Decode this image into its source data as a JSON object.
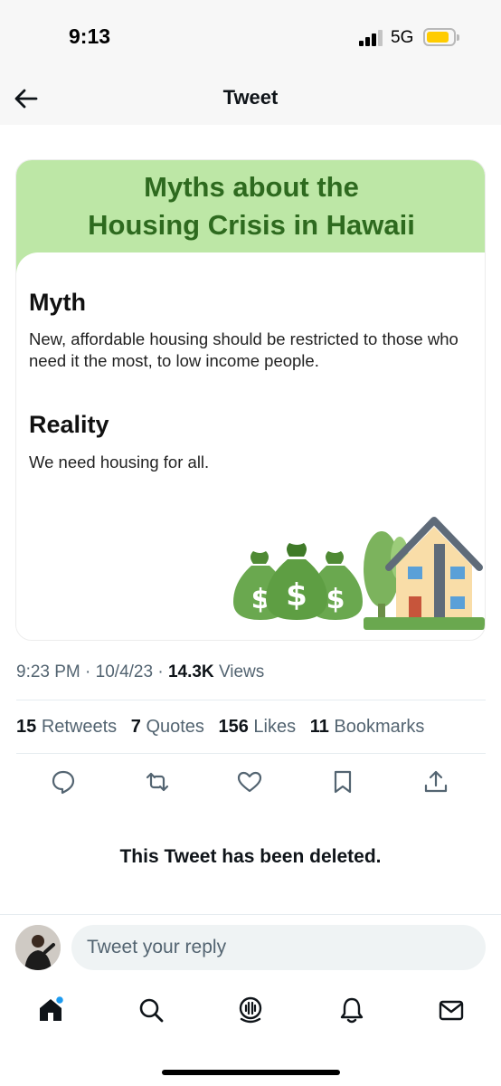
{
  "status_bar": {
    "time": "9:13",
    "network": "5G"
  },
  "header": {
    "title": "Tweet"
  },
  "card": {
    "banner_line1": "Myths about the",
    "banner_line2": "Housing Crisis in Hawaii",
    "myth_heading": "Myth",
    "myth_text": "New, affordable housing should be restricted to those who need it the most, to low income people.",
    "reality_heading": "Reality",
    "reality_text": "We need housing for all.",
    "colors": {
      "banner": "#bde7a6",
      "heading_green": "#2e6a1f",
      "bag_green": "#6aa84f"
    }
  },
  "meta": {
    "time": "9:23 PM",
    "sep1": "·",
    "date": "10/4/23",
    "sep2": "·",
    "views_count": "14.3K",
    "views_label": "Views"
  },
  "stats": [
    {
      "count": "15",
      "label": "Retweets"
    },
    {
      "count": "7",
      "label": "Quotes"
    },
    {
      "count": "156",
      "label": "Likes"
    },
    {
      "count": "11",
      "label": "Bookmarks"
    }
  ],
  "actions": [
    "reply-icon",
    "retweet-icon",
    "like-icon",
    "bookmark-icon",
    "share-icon"
  ],
  "deleted_notice": "This Tweet has been deleted.",
  "reply_box": {
    "placeholder": "Tweet your reply"
  },
  "tab_bar": [
    "home-icon",
    "search-icon",
    "spaces-icon",
    "notifications-icon",
    "messages-icon"
  ]
}
